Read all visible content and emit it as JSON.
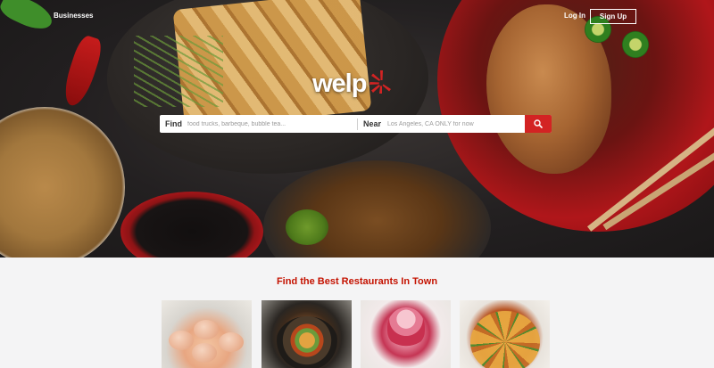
{
  "nav": {
    "businesses": "Businesses",
    "login": "Log In",
    "signup": "Sign Up"
  },
  "logo": {
    "text": "welp",
    "icon": "burst-icon",
    "color": "#d32323"
  },
  "search": {
    "find_label": "Find",
    "find_placeholder": "food trucks, barbeque, bubble tea...",
    "near_label": "Near",
    "near_placeholder": "Los Angeles, CA ONLY for now",
    "button_icon": "search-icon",
    "button_color": "#d32323"
  },
  "section": {
    "title": "Find the Best Restaurants In Town",
    "title_color": "#c41200",
    "cards": [
      {
        "image": "dumplings"
      },
      {
        "image": "bibimbap"
      },
      {
        "image": "shaved-ice"
      },
      {
        "image": "pasta"
      }
    ]
  }
}
